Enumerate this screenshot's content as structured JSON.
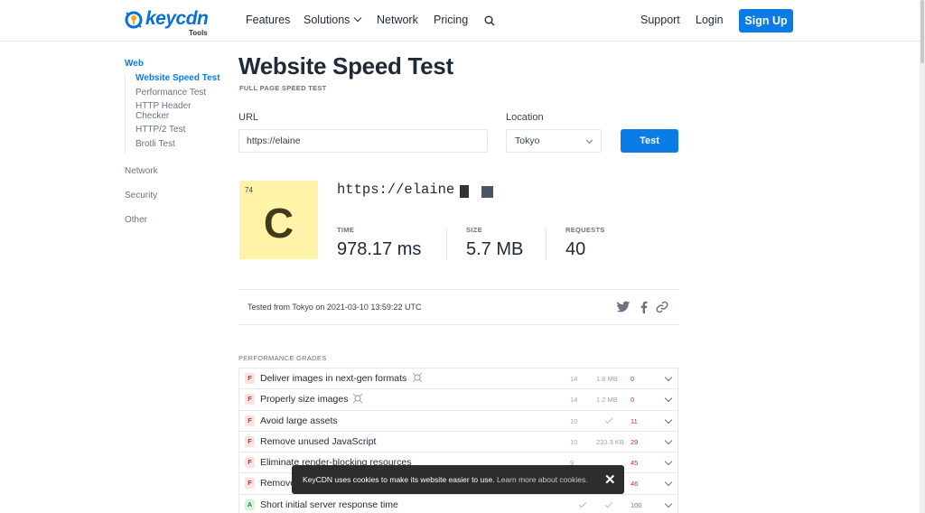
{
  "header": {
    "logo_text": "keycdn",
    "logo_sub": "Tools",
    "nav": [
      "Features",
      "Solutions",
      "Network",
      "Pricing"
    ],
    "right_nav": [
      "Support",
      "Login"
    ],
    "signup": "Sign Up"
  },
  "sidebar": {
    "web": "Web",
    "sub_items": [
      "Website Speed Test",
      "Performance Test",
      "HTTP Header Checker",
      "HTTP/2 Test",
      "Brotli Test"
    ],
    "items": [
      "Network",
      "Security",
      "Other"
    ]
  },
  "main": {
    "title": "Website Speed Test",
    "subtitle": "FULL PAGE SPEED TEST",
    "url_label": "URL",
    "url_value": "https://elaine",
    "location_label": "Location",
    "location_value": "Tokyo",
    "test_button": "Test"
  },
  "result": {
    "score": "74",
    "grade": "C",
    "url": "https://elaine",
    "time_label": "TIME",
    "time_value": "978.17 ms",
    "size_label": "SIZE",
    "size_value": "5.7 MB",
    "requests_label": "REQUESTS",
    "requests_value": "40",
    "tested_text": "Tested from Tokyo on 2021-03-10 13:59:22 UTC"
  },
  "performance": {
    "heading": "PERFORMANCE GRADES",
    "rows": [
      {
        "grade": "F",
        "name": "Deliver images in next-gen formats",
        "count": "14",
        "size": "1.8 MB",
        "score": "0"
      },
      {
        "grade": "F",
        "name": "Properly size images",
        "count": "14",
        "size": "1.2 MB",
        "score": "0"
      },
      {
        "grade": "F",
        "name": "Avoid large assets",
        "count": "10",
        "size": "",
        "score": "11"
      },
      {
        "grade": "F",
        "name": "Remove unused JavaScript",
        "count": "10",
        "size": "233.3 KB",
        "score": "29"
      },
      {
        "grade": "F",
        "name": "Eliminate render-blocking resources",
        "count": "9",
        "size": "",
        "score": "45"
      },
      {
        "grade": "F",
        "name": "Remove",
        "count": "",
        "size": "",
        "score": "46"
      },
      {
        "grade": "A",
        "name": "Short initial server response time",
        "count": "",
        "size": "",
        "score": "100"
      }
    ]
  },
  "cookie": {
    "message": "KeyCDN uses cookies to make its website easier to use.",
    "link": "Learn more about cookies.",
    "close": "✕"
  },
  "colors": {
    "accent": "#0b7be6",
    "grade_c_bg": "#fef3a6",
    "fail_red": "#c53030"
  }
}
